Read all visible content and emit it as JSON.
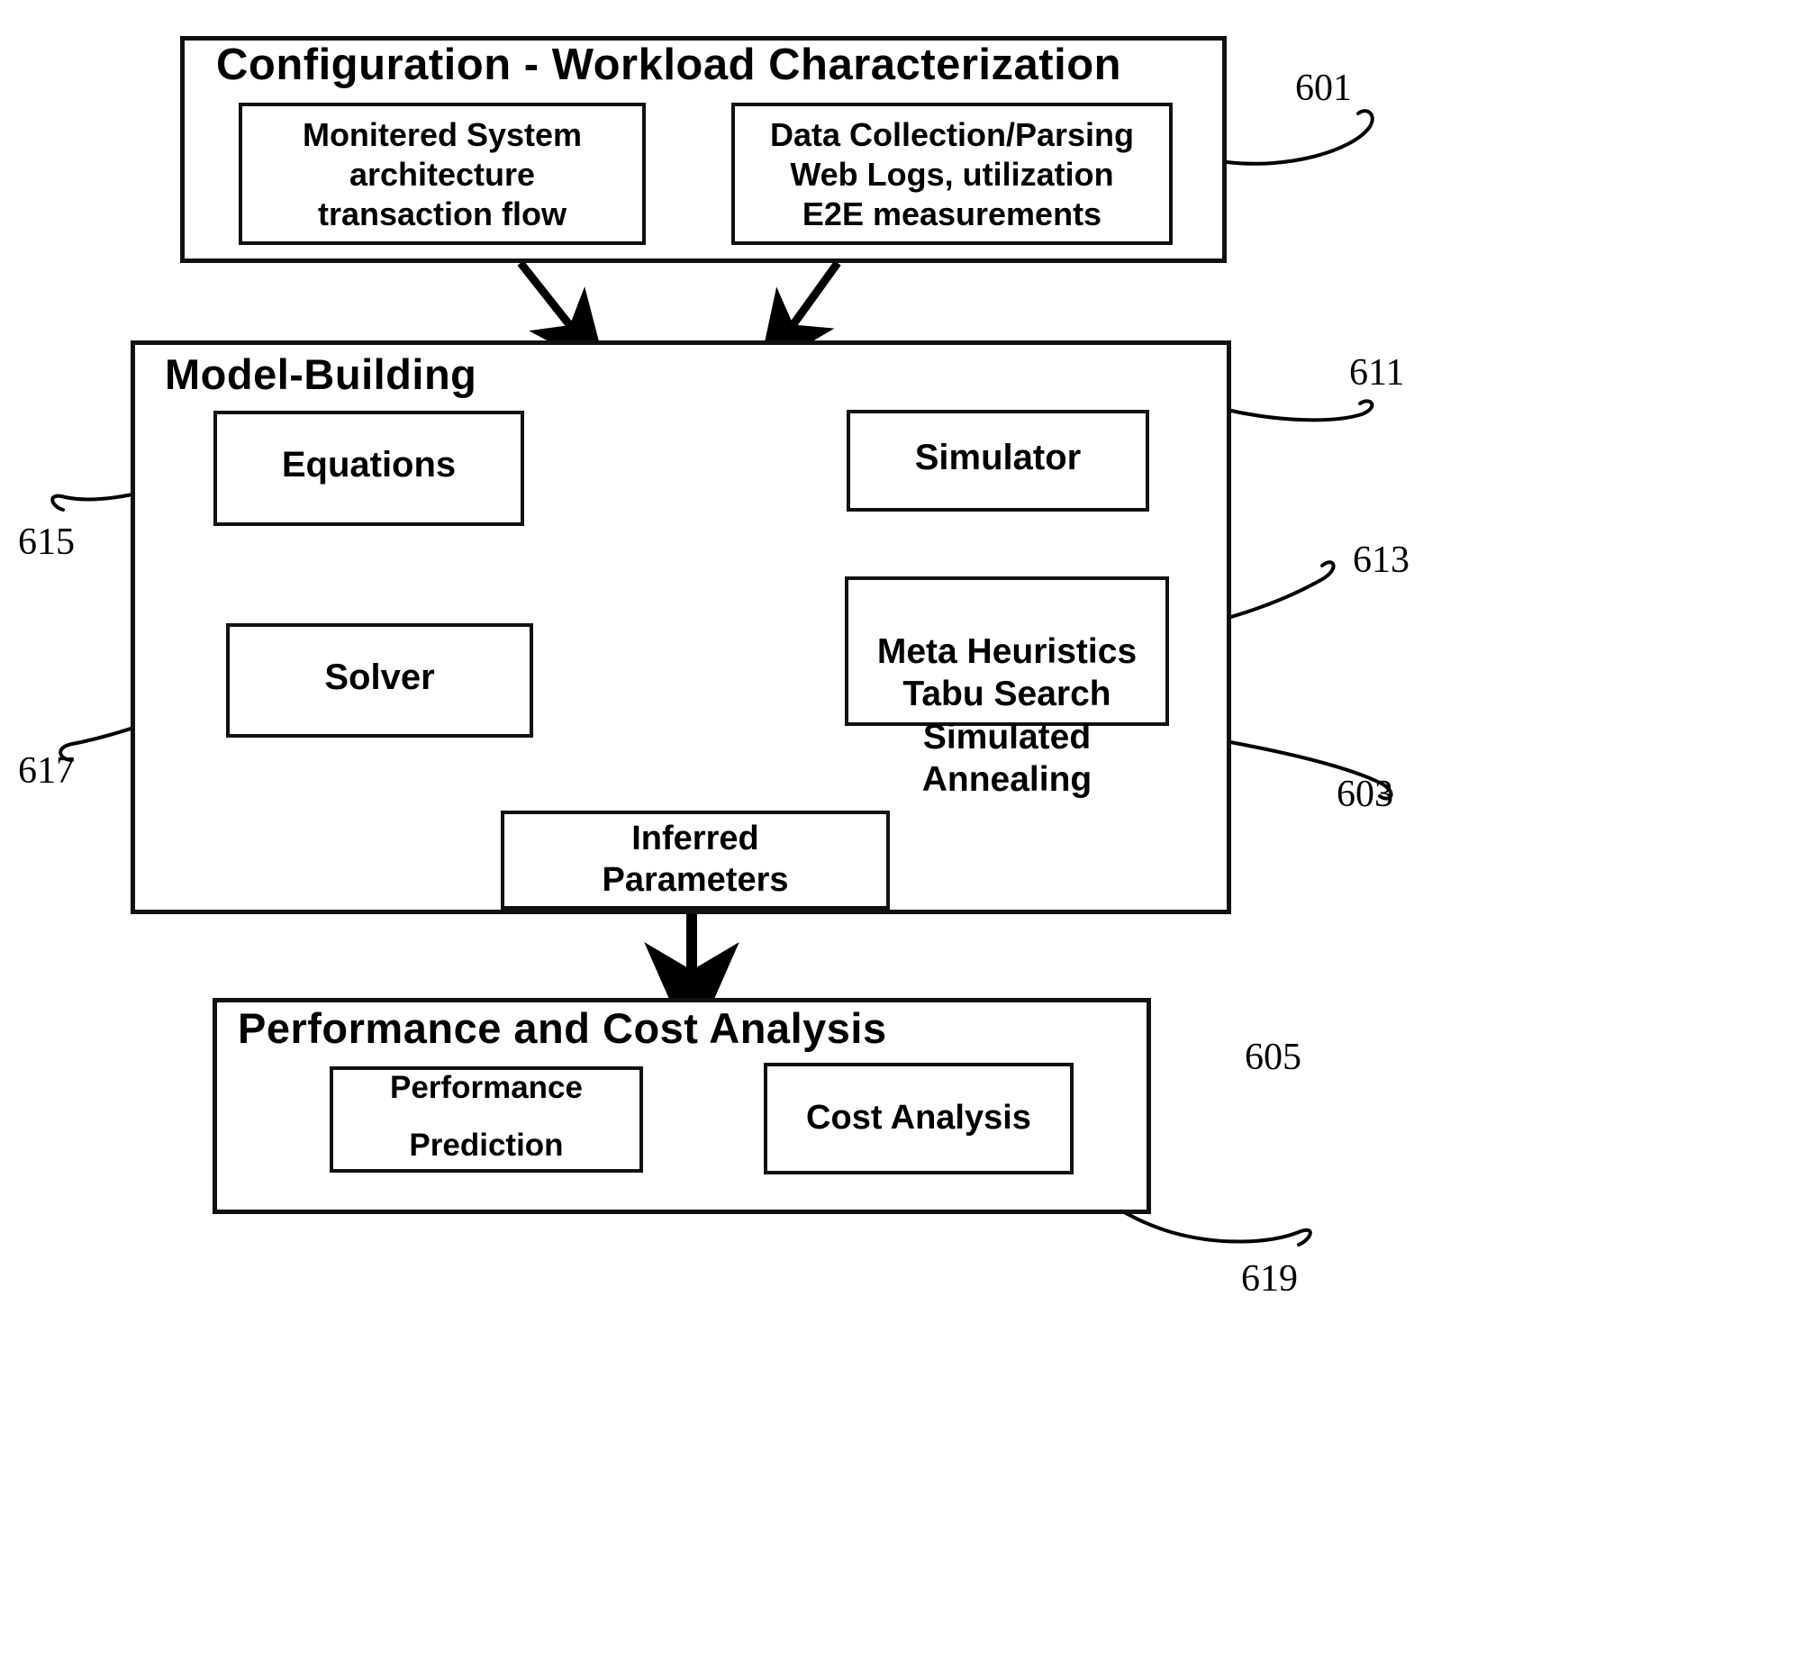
{
  "figure": {
    "type": "patent-block-diagram",
    "background": "#ffffff",
    "line_color": "#000000"
  },
  "sections": [
    {
      "id": "configuration",
      "title": "Configuration - Workload Characterization",
      "ref": "601",
      "boxes": [
        {
          "id": "monitored-system",
          "label": "Monitered System\narchitecture\ntransaction flow"
        },
        {
          "id": "data-collection",
          "label": "Data Collection/Parsing\nWeb Logs, utilization\nE2E measurements"
        }
      ]
    },
    {
      "id": "model-building",
      "title": "Model-Building",
      "ref": "603",
      "boxes": [
        {
          "id": "equations",
          "label": "Equations",
          "ref": "615"
        },
        {
          "id": "solver",
          "label": "Solver",
          "ref": "617"
        },
        {
          "id": "simulator",
          "label": "Simulator",
          "ref": "611"
        },
        {
          "id": "meta-heuristics",
          "label": "Meta Heuristics\nTabu Search\nSimulated Annealing",
          "ref": "613"
        },
        {
          "id": "inferred-parameters",
          "label": "Inferred\nParameters"
        }
      ]
    },
    {
      "id": "performance-cost",
      "title": "Performance and Cost Analysis",
      "ref": "605",
      "boxes": [
        {
          "id": "performance-prediction",
          "label": "Performance\n\nPrediction"
        },
        {
          "id": "cost-analysis",
          "label": "Cost Analysis",
          "ref": "619"
        }
      ]
    }
  ],
  "reference_numerals": {
    "n601": "601",
    "n603": "603",
    "n605": "605",
    "n611": "611",
    "n613": "613",
    "n615": "615",
    "n617": "617",
    "n619": "619"
  },
  "labels": {
    "config_title": "Configuration - Workload Characterization",
    "monitored_system": "Monitered System\narchitecture\ntransaction flow",
    "data_collection": "Data Collection/Parsing\nWeb Logs, utilization\nE2E measurements",
    "model_building_title": "Model-Building",
    "equations": "Equations",
    "solver": "Solver",
    "simulator": "Simulator",
    "meta_heuristics": "Meta Heuristics\nTabu Search\nSimulated Annealing",
    "inferred_parameters": "Inferred\nParameters",
    "perf_cost_title": "Performance and Cost Analysis",
    "performance_prediction": "Performance\n\nPrediction",
    "cost_analysis": "Cost Analysis"
  }
}
